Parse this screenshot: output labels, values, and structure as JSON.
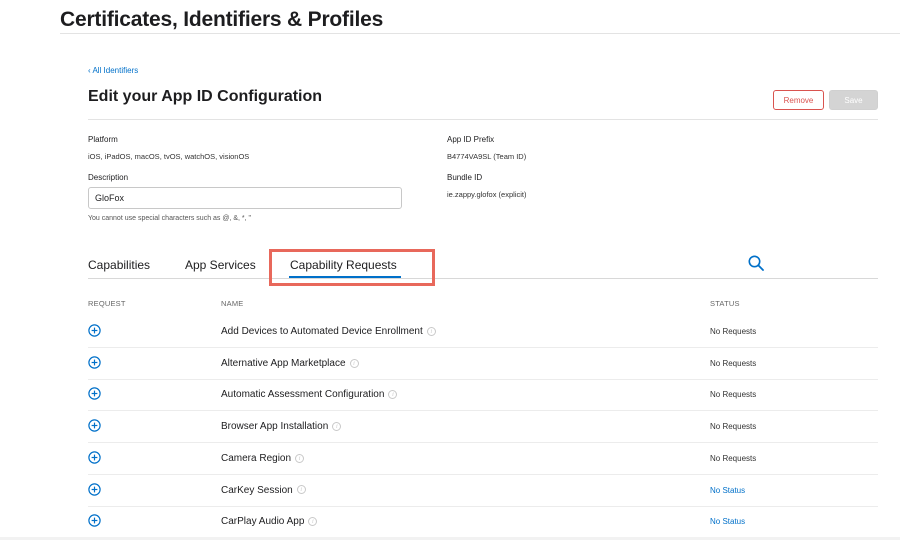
{
  "header": {
    "title": "Certificates, Identifiers & Profiles"
  },
  "nav": {
    "back_label": "‹ All Identifiers"
  },
  "section": {
    "title": "Edit your App ID Configuration"
  },
  "actions": {
    "remove_label": "Remove",
    "save_label": "Save"
  },
  "platform": {
    "label": "Platform",
    "value": "iOS, iPadOS, macOS, tvOS, watchOS, visionOS"
  },
  "description": {
    "label": "Description",
    "value": "GloFox",
    "hint": "You cannot use special characters such as @, &, *, \""
  },
  "app_id_prefix": {
    "label": "App ID Prefix",
    "value": "B4774VA9SL (Team ID)"
  },
  "bundle_id": {
    "label": "Bundle ID",
    "value": "ie.zappy.glofox (explicit)"
  },
  "tabs": [
    {
      "label": "Capabilities"
    },
    {
      "label": "App Services"
    },
    {
      "label": "Capability Requests",
      "active": true
    }
  ],
  "table": {
    "headers": {
      "request": "REQUEST",
      "name": "NAME",
      "status": "STATUS"
    },
    "rows": [
      {
        "name": "Add Devices to Automated Device Enrollment",
        "status": "No Requests",
        "status_link": false
      },
      {
        "name": "Alternative App Marketplace",
        "status": "No Requests",
        "status_link": false
      },
      {
        "name": "Automatic Assessment Configuration",
        "status": "No Requests",
        "status_link": false
      },
      {
        "name": "Browser App Installation",
        "status": "No Requests",
        "status_link": false
      },
      {
        "name": "Camera Region",
        "status": "No Requests",
        "status_link": false
      },
      {
        "name": "CarKey Session",
        "status": "No Status",
        "status_link": true
      },
      {
        "name": "CarPlay Audio App",
        "status": "No Status",
        "status_link": true
      }
    ]
  },
  "icons": {
    "search": "search-icon",
    "add": "plus-circle-icon",
    "info": "info-icon"
  },
  "colors": {
    "accent": "#0070c9",
    "danger": "#d9534f",
    "highlight": "#e8685b"
  }
}
